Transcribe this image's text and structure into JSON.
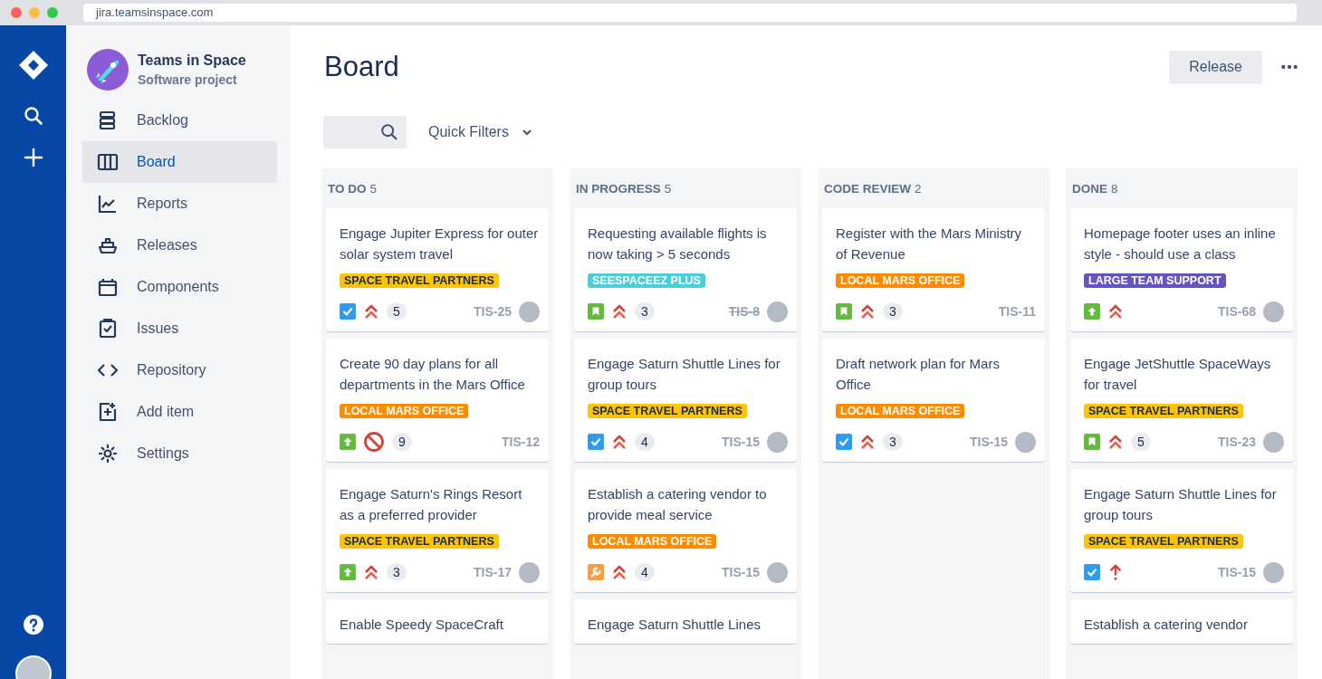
{
  "browser": {
    "url": "jira.teamsinspace.com"
  },
  "project": {
    "name": "Teams in Space",
    "type": "Software project"
  },
  "nav": [
    {
      "label": "Backlog",
      "selected": false
    },
    {
      "label": "Board",
      "selected": true
    },
    {
      "label": "Reports",
      "selected": false
    },
    {
      "label": "Releases",
      "selected": false
    },
    {
      "label": "Components",
      "selected": false
    },
    {
      "label": "Issues",
      "selected": false
    },
    {
      "label": "Repository",
      "selected": false
    },
    {
      "label": "Add item",
      "selected": false
    },
    {
      "label": "Settings",
      "selected": false
    }
  ],
  "header": {
    "title": "Board",
    "release_button": "Release"
  },
  "filters": {
    "quick_filters": "Quick Filters"
  },
  "columns": [
    {
      "name": "TO DO",
      "count": "5",
      "cards": [
        {
          "title": "Engage Jupiter Express for outer solar system travel",
          "epic": "SPACE TRAVEL PARTNERS",
          "color": "#ffc400",
          "type": {
            "kind": "task"
          },
          "priority": {
            "kind": "highest"
          },
          "points": "5",
          "key": "TIS-25",
          "done": false,
          "avatar": true
        },
        {
          "title": "Create 90 day plans for all departments in the Mars Office",
          "epic": "LOCAL MARS OFFICE",
          "color": "#ff8b00",
          "type": {
            "kind": "improvement"
          },
          "priority": {
            "kind": "blocker"
          },
          "points": "9",
          "key": "TIS-12",
          "done": false,
          "avatar": false
        },
        {
          "title": "Engage Saturn's Rings Resort as a preferred provider",
          "epic": "SPACE TRAVEL PARTNERS",
          "color": "#ffc400",
          "type": {
            "kind": "improvement"
          },
          "priority": {
            "kind": "highest"
          },
          "points": "3",
          "key": "TIS-17",
          "done": false,
          "avatar": true
        },
        {
          "title": "Enable Speedy SpaceCraft"
        }
      ]
    },
    {
      "name": "IN PROGRESS",
      "count": "5",
      "cards": [
        {
          "title": "Requesting available flights is now taking > 5 seconds",
          "epic": "SEESPACEEZ PLUS",
          "color": "#4bcddc",
          "type": {
            "kind": "story"
          },
          "priority": {
            "kind": "highest"
          },
          "points": "3",
          "key": "TIS-8",
          "done": true,
          "avatar": true
        },
        {
          "title": "Engage Saturn Shuttle Lines for group tours",
          "epic": "SPACE TRAVEL PARTNERS",
          "color": "#ffc400",
          "type": {
            "kind": "task"
          },
          "priority": {
            "kind": "highest"
          },
          "points": "4",
          "key": "TIS-15",
          "done": false,
          "avatar": true
        },
        {
          "title": "Establish a catering vendor to provide meal service",
          "epic": "LOCAL MARS OFFICE",
          "color": "#ff8b00",
          "type": {
            "kind": "subtask"
          },
          "priority": {
            "kind": "highest"
          },
          "points": "4",
          "key": "TIS-15",
          "done": false,
          "avatar": true
        },
        {
          "title": "Engage Saturn Shuttle Lines"
        }
      ]
    },
    {
      "name": "CODE REVIEW",
      "count": "2",
      "cards": [
        {
          "title": "Register with the Mars Ministry of Revenue",
          "epic": "LOCAL MARS OFFICE",
          "color": "#ff8b00",
          "type": {
            "kind": "story"
          },
          "priority": {
            "kind": "highest"
          },
          "points": "3",
          "key": "TIS-11",
          "done": false,
          "avatar": false
        },
        {
          "title": "Draft network plan for Mars Office",
          "epic": "LOCAL MARS OFFICE",
          "color": "#ff8b00",
          "type": {
            "kind": "task"
          },
          "priority": {
            "kind": "highest"
          },
          "points": "3",
          "key": "TIS-15",
          "done": false,
          "avatar": true
        }
      ]
    },
    {
      "name": "DONE",
      "count": "8",
      "cards": [
        {
          "title": "Homepage footer uses an inline style - should use a class",
          "epic": "LARGE TEAM SUPPORT",
          "color": "#6554c0",
          "type": {
            "kind": "improvement"
          },
          "priority": {
            "kind": "highest"
          },
          "key": "TIS-68",
          "done": false,
          "avatar": true
        },
        {
          "title": "Engage JetShuttle SpaceWays for travel",
          "epic": "SPACE TRAVEL PARTNERS",
          "color": "#ffc400",
          "type": {
            "kind": "story"
          },
          "priority": {
            "kind": "highest"
          },
          "points": "5",
          "key": "TIS-23",
          "done": false,
          "avatar": true
        },
        {
          "title": "Engage Saturn Shuttle Lines for group tours",
          "epic": "SPACE TRAVEL PARTNERS",
          "color": "#ffc400",
          "type": {
            "kind": "task"
          },
          "priority": {
            "kind": "high"
          },
          "key": "TIS-15",
          "done": false,
          "avatar": true
        },
        {
          "title": "Establish a catering vendor"
        }
      ]
    }
  ]
}
